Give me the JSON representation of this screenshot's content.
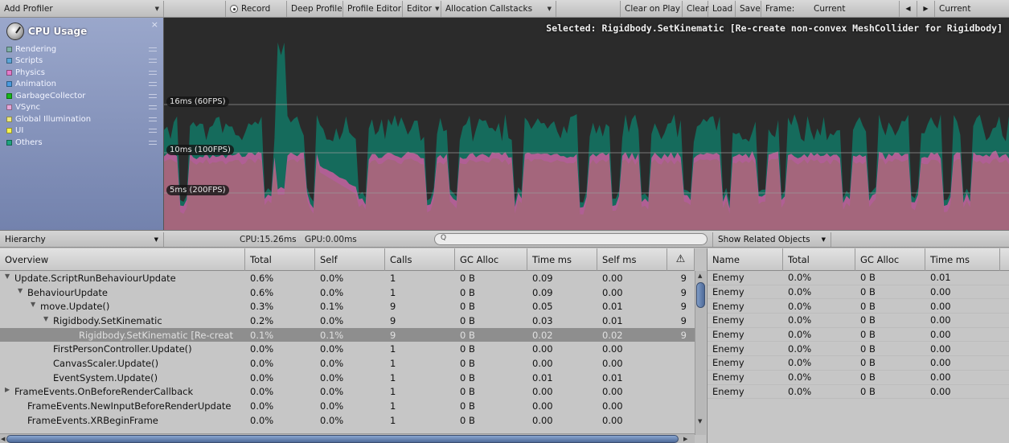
{
  "toolbar": {
    "add_profiler": "Add Profiler",
    "record": "Record",
    "deep_profile": "Deep Profile",
    "profile_editor": "Profile Editor",
    "editor": "Editor",
    "allocation_callstacks": "Allocation Callstacks",
    "clear_on_play": "Clear on Play",
    "clear": "Clear",
    "load": "Load",
    "save": "Save",
    "frame_label": "Frame:",
    "frame_value": "Current",
    "prev": "◀",
    "next": "▶",
    "current": "Current"
  },
  "module": {
    "title": "CPU Usage",
    "close": "×",
    "legend": [
      {
        "label": "Rendering",
        "color": "#7db0a6"
      },
      {
        "label": "Scripts",
        "color": "#5ba5d8"
      },
      {
        "label": "Physics",
        "color": "#e57acb"
      },
      {
        "label": "Animation",
        "color": "#4a9adf"
      },
      {
        "label": "GarbageCollector",
        "color": "#18b81b"
      },
      {
        "label": "VSync",
        "color": "#e8a6d8"
      },
      {
        "label": "Global Illumination",
        "color": "#ece87a"
      },
      {
        "label": "UI",
        "color": "#f7f34e"
      },
      {
        "label": "Others",
        "color": "#1fa47f"
      }
    ]
  },
  "chart": {
    "selected": "Selected: Rigidbody.SetKinematic [Re-create non-convex MeshCollider for Rigidbody]",
    "lines": [
      "16ms (60FPS)",
      "10ms (100FPS)",
      "5ms (200FPS)"
    ],
    "colors": {
      "others": "#156b5c",
      "physics": "#b05f94",
      "rendering": "#a4667c",
      "bg": "#2b2b2b"
    }
  },
  "bar2": {
    "view": "Hierarchy",
    "cpu": "CPU:15.26ms",
    "gpu": "GPU:0.00ms",
    "search_icon": "Q",
    "related": "Show Related Objects"
  },
  "table": {
    "columns": [
      "Overview",
      "Total",
      "Self",
      "Calls",
      "GC Alloc",
      "Time ms",
      "Self ms"
    ],
    "warning_icon": "⚠",
    "rows": [
      {
        "name": "Update.ScriptRunBehaviourUpdate",
        "indent": 0,
        "expand": "▼",
        "total": "0.6%",
        "self": "0.0%",
        "calls": "1",
        "gc": "0 B",
        "time": "0.09",
        "selfms": "0.00",
        "warn": "9"
      },
      {
        "name": "BehaviourUpdate",
        "indent": 1,
        "expand": "▼",
        "total": "0.6%",
        "self": "0.0%",
        "calls": "1",
        "gc": "0 B",
        "time": "0.09",
        "selfms": "0.00",
        "warn": "9"
      },
      {
        "name": "move.Update()",
        "indent": 2,
        "expand": "▼",
        "total": "0.3%",
        "self": "0.1%",
        "calls": "9",
        "gc": "0 B",
        "time": "0.05",
        "selfms": "0.01",
        "warn": "9"
      },
      {
        "name": "Rigidbody.SetKinematic",
        "indent": 3,
        "expand": "▼",
        "total": "0.2%",
        "self": "0.0%",
        "calls": "9",
        "gc": "0 B",
        "time": "0.03",
        "selfms": "0.01",
        "warn": "9"
      },
      {
        "name": "Rigidbody.SetKinematic [Re-creat",
        "indent": 5,
        "expand": "",
        "total": "0.1%",
        "self": "0.1%",
        "calls": "9",
        "gc": "0 B",
        "time": "0.02",
        "selfms": "0.02",
        "warn": "9",
        "selected": true
      },
      {
        "name": "FirstPersonController.Update()",
        "indent": 3,
        "expand": "",
        "total": "0.0%",
        "self": "0.0%",
        "calls": "1",
        "gc": "0 B",
        "time": "0.00",
        "selfms": "0.00",
        "warn": ""
      },
      {
        "name": "CanvasScaler.Update()",
        "indent": 3,
        "expand": "",
        "total": "0.0%",
        "self": "0.0%",
        "calls": "1",
        "gc": "0 B",
        "time": "0.00",
        "selfms": "0.00",
        "warn": ""
      },
      {
        "name": "EventSystem.Update()",
        "indent": 3,
        "expand": "",
        "total": "0.0%",
        "self": "0.0%",
        "calls": "1",
        "gc": "0 B",
        "time": "0.01",
        "selfms": "0.01",
        "warn": ""
      },
      {
        "name": "FrameEvents.OnBeforeRenderCallback",
        "indent": 0,
        "expand": "▶",
        "total": "0.0%",
        "self": "0.0%",
        "calls": "1",
        "gc": "0 B",
        "time": "0.00",
        "selfms": "0.00",
        "warn": ""
      },
      {
        "name": "FrameEvents.NewInputBeforeRenderUpdate",
        "indent": 1,
        "expand": "",
        "total": "0.0%",
        "self": "0.0%",
        "calls": "1",
        "gc": "0 B",
        "time": "0.00",
        "selfms": "0.00",
        "warn": ""
      },
      {
        "name": "FrameEvents.XRBeginFrame",
        "indent": 1,
        "expand": "",
        "total": "0.0%",
        "self": "0.0%",
        "calls": "1",
        "gc": "0 B",
        "time": "0.00",
        "selfms": "0.00",
        "warn": ""
      }
    ]
  },
  "related": {
    "columns": [
      "Name",
      "Total",
      "GC Alloc",
      "Time ms"
    ],
    "rows": [
      {
        "name": "Enemy",
        "total": "0.0%",
        "gc": "0 B",
        "time": "0.01"
      },
      {
        "name": "Enemy",
        "total": "0.0%",
        "gc": "0 B",
        "time": "0.00"
      },
      {
        "name": "Enemy",
        "total": "0.0%",
        "gc": "0 B",
        "time": "0.00"
      },
      {
        "name": "Enemy",
        "total": "0.0%",
        "gc": "0 B",
        "time": "0.00"
      },
      {
        "name": "Enemy",
        "total": "0.0%",
        "gc": "0 B",
        "time": "0.00"
      },
      {
        "name": "Enemy",
        "total": "0.0%",
        "gc": "0 B",
        "time": "0.00"
      },
      {
        "name": "Enemy",
        "total": "0.0%",
        "gc": "0 B",
        "time": "0.00"
      },
      {
        "name": "Enemy",
        "total": "0.0%",
        "gc": "0 B",
        "time": "0.00"
      },
      {
        "name": "Enemy",
        "total": "0.0%",
        "gc": "0 B",
        "time": "0.00"
      }
    ]
  },
  "scroll": {
    "up": "▲",
    "down": "▼",
    "left": "◀",
    "right": "▶"
  }
}
